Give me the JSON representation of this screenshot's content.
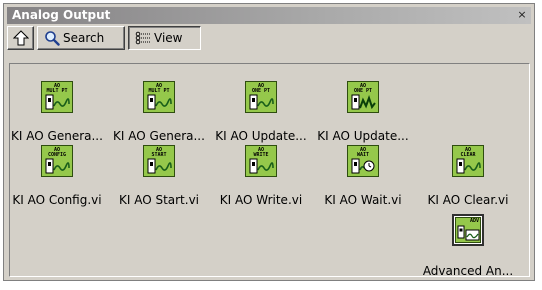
{
  "window": {
    "title": "Analog Output",
    "close_glyph": "×"
  },
  "toolbar": {
    "up_icon": "up-arrow-icon",
    "search_label": "Search",
    "view_label": "View"
  },
  "palette": {
    "items": [
      {
        "icon_lines": [
          "AO",
          "MULT PT"
        ],
        "label": "KI AO Genera..."
      },
      {
        "icon_lines": [
          "AO",
          "MULT PT"
        ],
        "label": "KI AO Genera..."
      },
      {
        "icon_lines": [
          "AO",
          "ONE PT"
        ],
        "label": "KI AO Update..."
      },
      {
        "icon_lines": [
          "AO",
          "ONE PT"
        ],
        "label": "KI AO Update..."
      },
      {
        "icon_lines": [
          "AO",
          "CONFIG"
        ],
        "label": "KI AO Config.vi"
      },
      {
        "icon_lines": [
          "AO",
          "START"
        ],
        "label": "KI AO Start.vi"
      },
      {
        "icon_lines": [
          "AO",
          "WRITE"
        ],
        "label": "KI AO Write.vi"
      },
      {
        "icon_lines": [
          "AO",
          "WAIT"
        ],
        "label": "KI AO Wait.vi"
      },
      {
        "icon_lines": [
          "AO",
          "CLEAR"
        ],
        "label": "KI AO Clear.vi"
      },
      {
        "icon_lines": [
          "ADV"
        ],
        "label": "Advanced An..."
      }
    ]
  },
  "colors": {
    "icon_green": "#95c84b",
    "icon_border": "#2e4d0f",
    "window_bg": "#d4d0c8"
  }
}
